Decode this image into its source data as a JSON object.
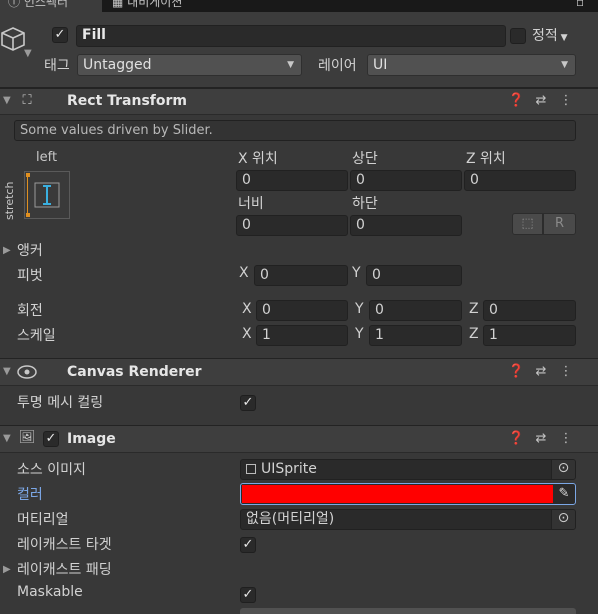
{
  "tabs": [
    {
      "label": "인스펙터"
    },
    {
      "label": "내비게이션"
    }
  ],
  "object": {
    "active": "✓",
    "name": "Fill",
    "static_label": "정적",
    "tag_label": "태그",
    "tag_value": "Untagged",
    "layer_label": "레이어",
    "layer_value": "UI"
  },
  "rect_transform": {
    "title": "Rect Transform",
    "note": "Some values driven by Slider.",
    "anchor_h": "left",
    "anchor_v": "stretch",
    "pos_x_label": "X 위치",
    "pos_x": "0",
    "top_label": "상단",
    "top": "0",
    "pos_z_label": "Z 위치",
    "pos_z": "0",
    "width_label": "너비",
    "width": "0",
    "bottom_label": "하단",
    "bottom": "0",
    "anchors_label": "앵커",
    "pivot_label": "피벗",
    "pivot_x": "0",
    "pivot_y": "0",
    "rotation_label": "회전",
    "rot_x": "0",
    "rot_y": "0",
    "rot_z": "0",
    "scale_label": "스케일",
    "scale_x": "1",
    "scale_y": "1",
    "scale_z": "1",
    "x": "X",
    "y": "Y",
    "z": "Z",
    "raw_btn": "R"
  },
  "canvas_renderer": {
    "title": "Canvas Renderer",
    "cull_label": "투명 메시 컬링",
    "cull": "✓"
  },
  "image": {
    "title": "Image",
    "enabled": "✓",
    "source_label": "소스 이미지",
    "source_value": "UISprite",
    "color_label": "컬러",
    "color_value": "#ff0000",
    "material_label": "머티리얼",
    "material_value": "없음(머티리얼)",
    "raycast_label": "레이캐스트 타겟",
    "raycast": "✓",
    "padding_label": "레이캐스트 패딩",
    "maskable_label": "Maskable",
    "maskable": "✓"
  },
  "colors": {
    "accent_blue": "#7ba7e6",
    "color_swatch": "#ff0000",
    "background": "#383838"
  }
}
